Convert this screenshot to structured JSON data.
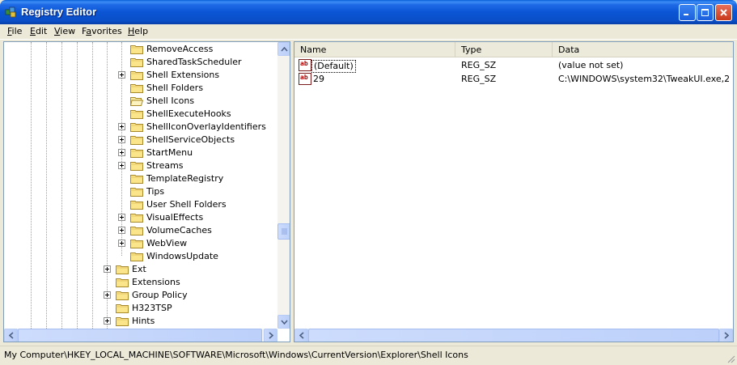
{
  "window": {
    "title": "Registry Editor"
  },
  "menu": [
    {
      "accel": "F",
      "rest": "ile"
    },
    {
      "accel": "E",
      "rest": "dit"
    },
    {
      "accel": "V",
      "rest": "iew"
    },
    {
      "accel": "",
      "rest": "Favorites",
      "underline_index": 1
    },
    {
      "accel": "H",
      "rest": "elp"
    }
  ],
  "tree": {
    "items": [
      {
        "label": "RemoveAccess",
        "expander": false
      },
      {
        "label": "SharedTaskScheduler",
        "expander": false
      },
      {
        "label": "Shell Extensions",
        "expander": true
      },
      {
        "label": "Shell Folders",
        "expander": false
      },
      {
        "label": "Shell Icons",
        "expander": false,
        "open": true
      },
      {
        "label": "ShellExecuteHooks",
        "expander": false
      },
      {
        "label": "ShellIconOverlayIdentifiers",
        "expander": true
      },
      {
        "label": "ShellServiceObjects",
        "expander": true
      },
      {
        "label": "StartMenu",
        "expander": true
      },
      {
        "label": "Streams",
        "expander": true
      },
      {
        "label": "TemplateRegistry",
        "expander": false
      },
      {
        "label": "Tips",
        "expander": false
      },
      {
        "label": "User Shell Folders",
        "expander": false
      },
      {
        "label": "VisualEffects",
        "expander": true
      },
      {
        "label": "VolumeCaches",
        "expander": true
      },
      {
        "label": "WebView",
        "expander": true
      },
      {
        "label": "WindowsUpdate",
        "expander": false
      }
    ],
    "parent_items": [
      {
        "label": "Ext",
        "expander": true
      },
      {
        "label": "Extensions",
        "expander": false
      },
      {
        "label": "Group Policy",
        "expander": true
      },
      {
        "label": "H323TSP",
        "expander": false
      },
      {
        "label": "Hints",
        "expander": true
      }
    ]
  },
  "list": {
    "columns": [
      "Name",
      "Type",
      "Data"
    ],
    "rows": [
      {
        "name": "(Default)",
        "type": "REG_SZ",
        "data": "(value not set)"
      },
      {
        "name": "29",
        "type": "REG_SZ",
        "data": "C:\\WINDOWS\\system32\\TweakUI.exe,2"
      }
    ]
  },
  "status": {
    "path": "My Computer\\HKEY_LOCAL_MACHINE\\SOFTWARE\\Microsoft\\Windows\\CurrentVersion\\Explorer\\Shell Icons"
  },
  "colors": {
    "titlebar": "#0a55d4",
    "chrome": "#ece9d8",
    "pane_border": "#7f9db9",
    "scroll_btn": "#c3d5fa"
  }
}
